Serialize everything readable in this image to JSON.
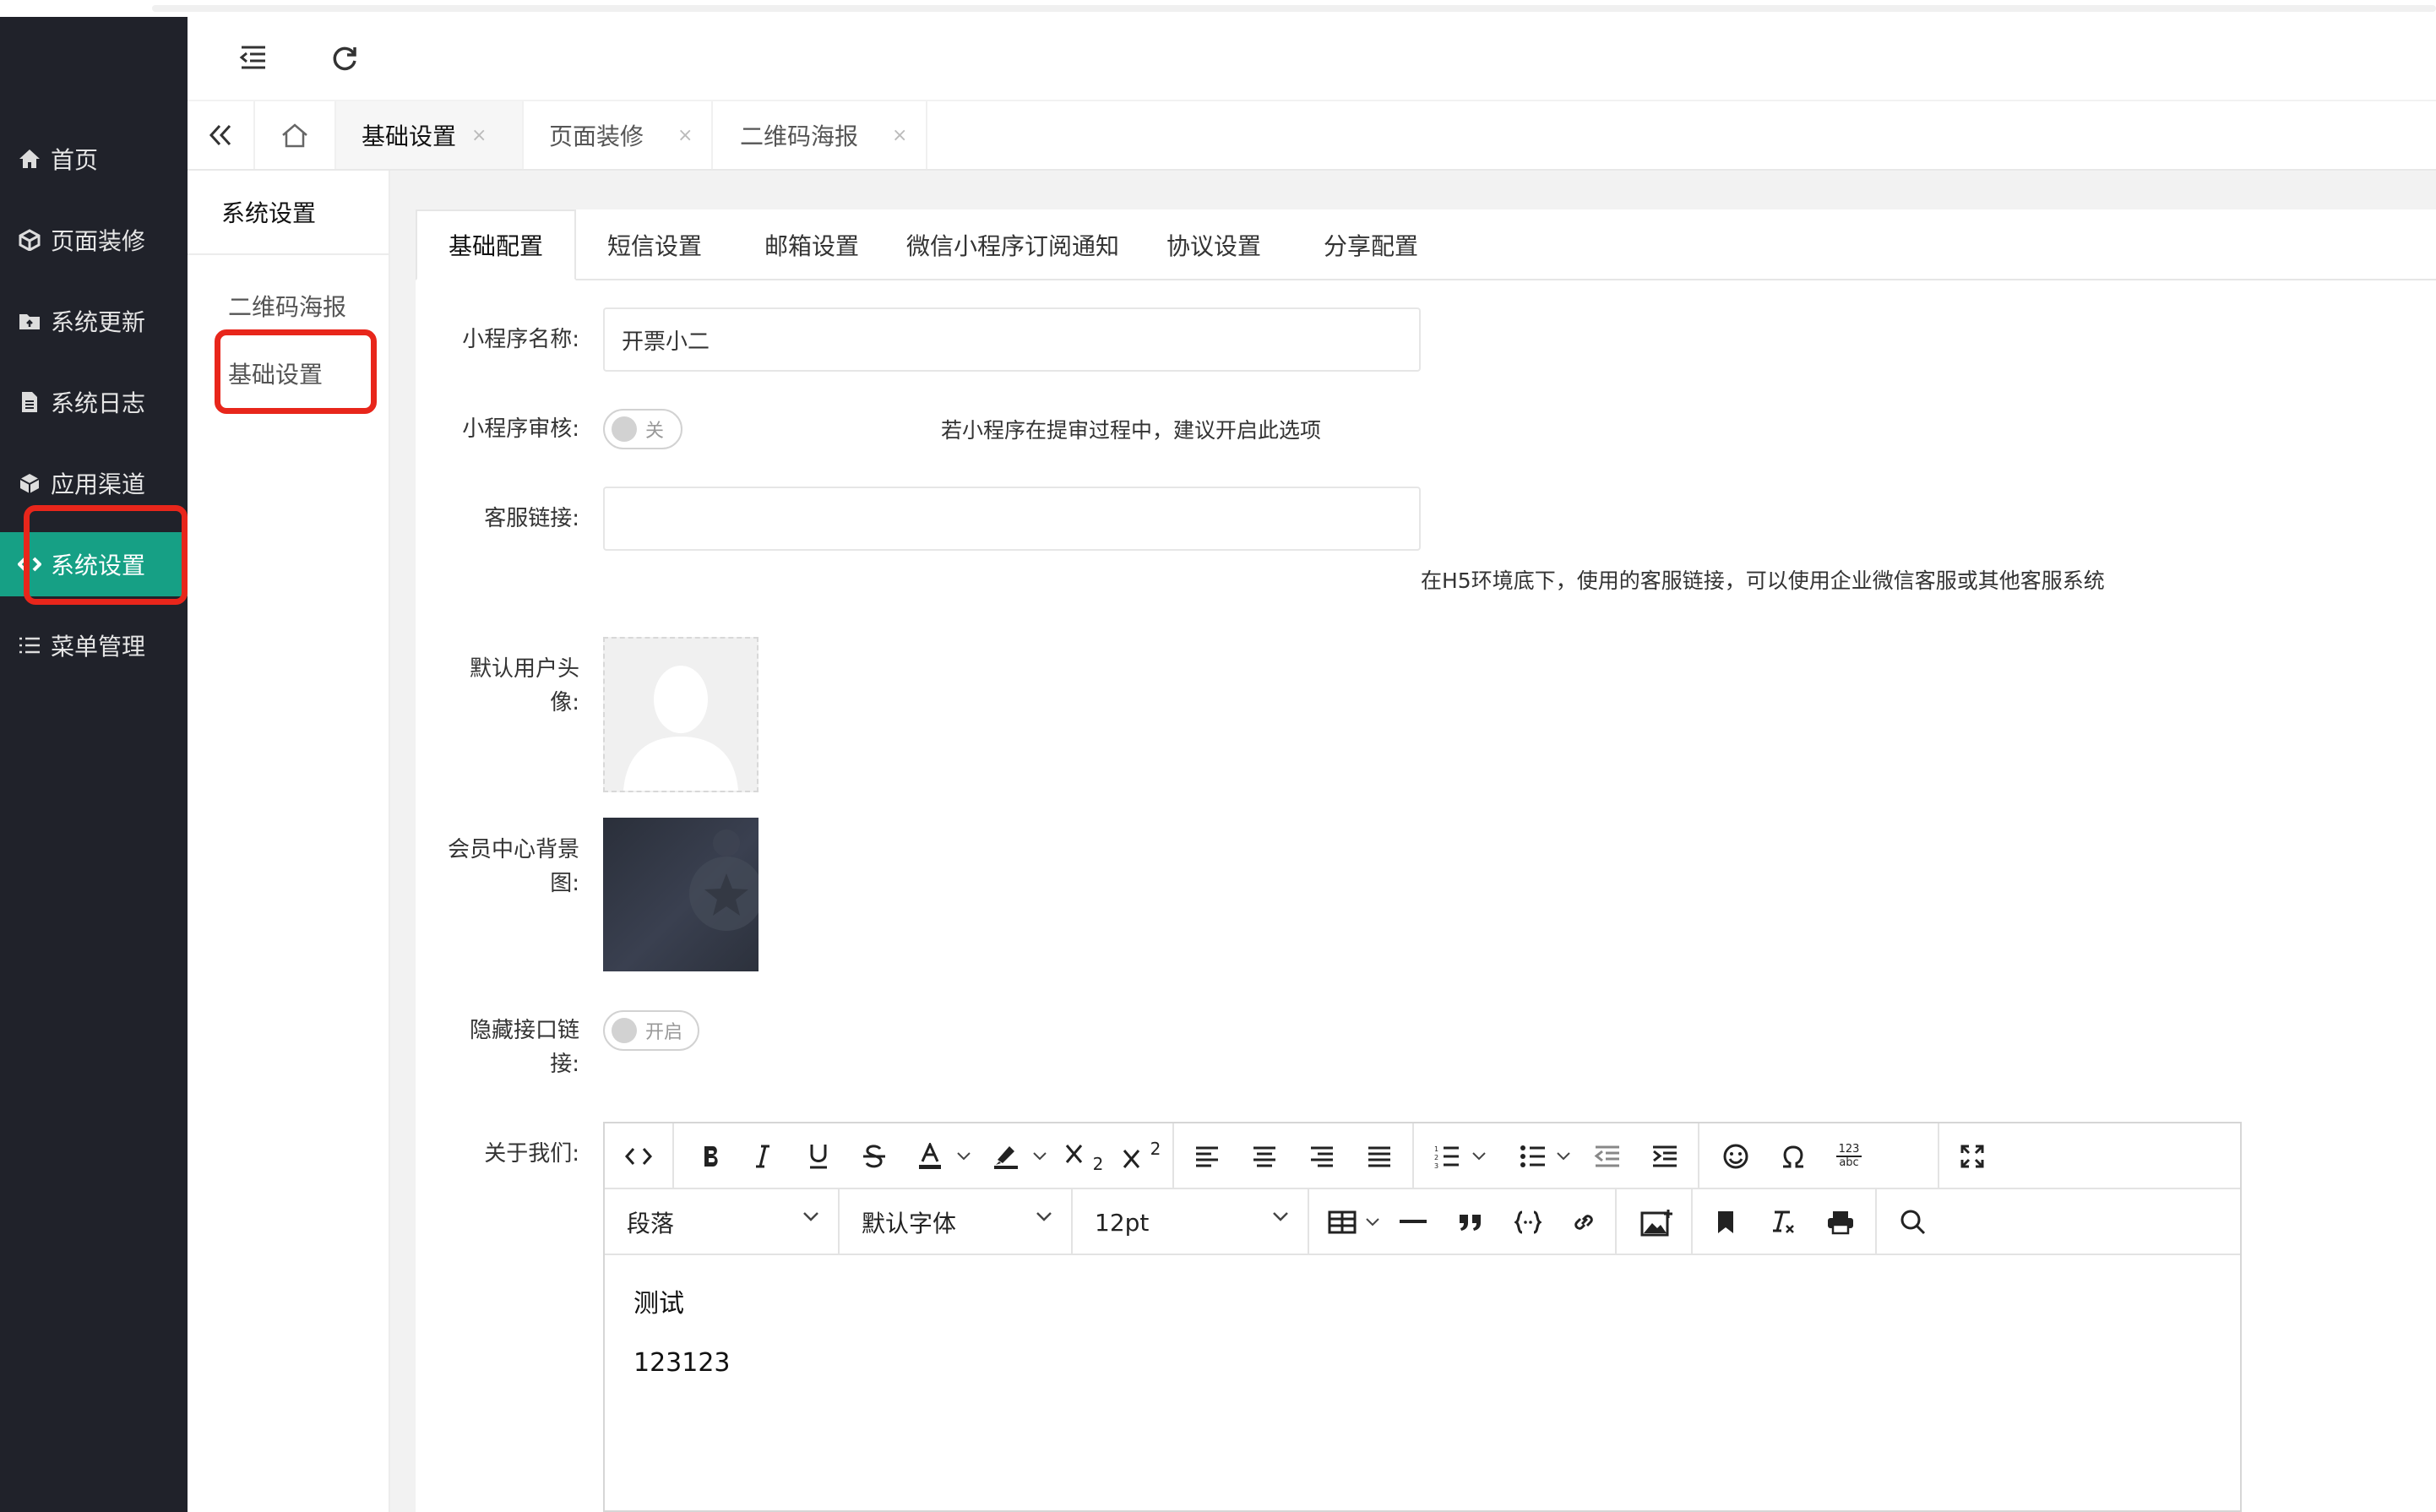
{
  "sidebar": {
    "items": [
      {
        "label": "首页",
        "icon": "home-icon"
      },
      {
        "label": "页面装修",
        "icon": "cube-icon"
      },
      {
        "label": "系统更新",
        "icon": "folder-icon"
      },
      {
        "label": "系统日志",
        "icon": "document-icon"
      },
      {
        "label": "应用渠道",
        "icon": "box-icon"
      },
      {
        "label": "系统设置",
        "icon": "settings-icon",
        "active": true
      },
      {
        "label": "菜单管理",
        "icon": "list-icon"
      }
    ]
  },
  "header": {
    "collapse_icon": "collapse-menu-icon",
    "refresh_icon": "refresh-icon"
  },
  "page_tabs": {
    "items": [
      {
        "label": "基础设置",
        "active": true
      },
      {
        "label": "页面装修"
      },
      {
        "label": "二维码海报"
      }
    ],
    "close_glyph": "×"
  },
  "subnav": {
    "title": "系统设置",
    "items": [
      {
        "label": "二维码海报"
      },
      {
        "label": "基础设置",
        "active": true
      }
    ]
  },
  "config_tabs": [
    {
      "label": "基础配置",
      "active": true
    },
    {
      "label": "短信设置"
    },
    {
      "label": "邮箱设置"
    },
    {
      "label": "微信小程序订阅通知"
    },
    {
      "label": "协议设置"
    },
    {
      "label": "分享配置"
    }
  ],
  "form": {
    "app_name_label": "小程序名称:",
    "app_name_value": "开票小二",
    "review_label": "小程序审核:",
    "review_switch": "关",
    "review_hint": "若小程序在提审过程中，建议开启此选项",
    "service_link_label": "客服链接:",
    "service_link_value": "",
    "service_link_hint": "在H5环境底下，使用的客服链接，可以使用企业微信客服或其他客服系统",
    "avatar_label_1": "默认用户头",
    "avatar_label_2": "像:",
    "member_bg_label_1": "会员中心背景",
    "member_bg_label_2": "图:",
    "hide_api_label_1": "隐藏接口链",
    "hide_api_label_2": "接:",
    "hide_api_switch": "开启",
    "about_label": "关于我们:"
  },
  "editor": {
    "paragraph_select": "段落",
    "font_select": "默认字体",
    "size_select": "12pt",
    "content_lines": [
      "测试",
      "123123"
    ],
    "superscript": "2",
    "subscript": "2",
    "charmap_top": "123",
    "charmap_bottom": "abc"
  },
  "colors": {
    "sidebar_bg": "#20222a",
    "sidebar_active": "#16a085",
    "highlight_red": "#e8261b"
  }
}
